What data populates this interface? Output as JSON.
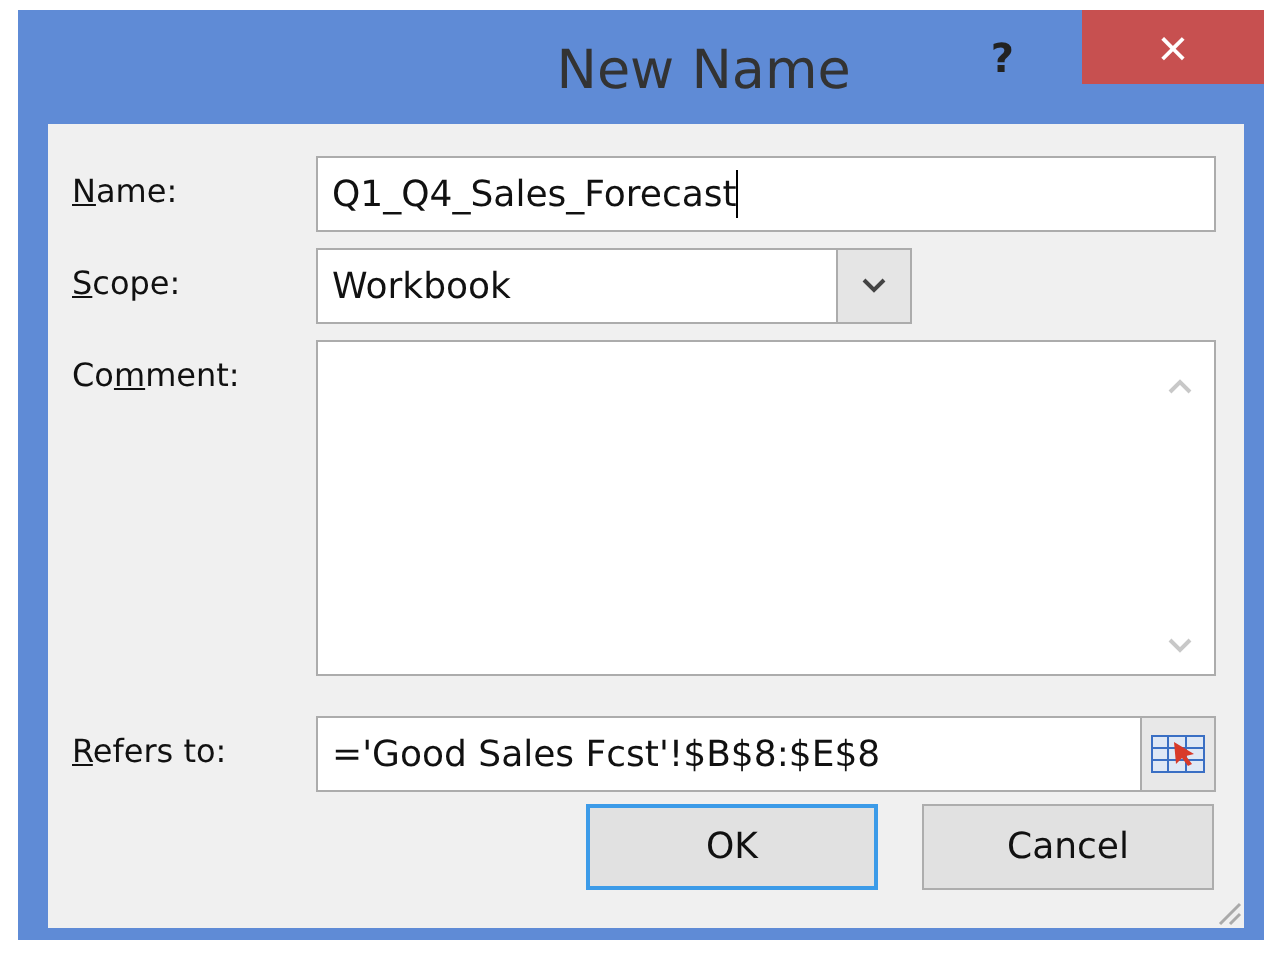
{
  "window": {
    "title": "New Name",
    "help": "?",
    "close": "×"
  },
  "fields": [
    {
      "kind": "text",
      "label": [
        {
          "text": "N",
          "access_key": true
        },
        {
          "text": "ame:",
          "access_key": false
        }
      ],
      "value": "Q1_Q4_Sales_Forecast",
      "focused": true
    },
    {
      "kind": "dropdown",
      "label": [
        {
          "text": "S",
          "access_key": true
        },
        {
          "text": "cope:",
          "access_key": false
        }
      ],
      "value": "Workbook"
    },
    {
      "kind": "memo",
      "label": [
        {
          "text": "Co",
          "access_key": false
        },
        {
          "text": "m",
          "access_key": true
        },
        {
          "text": "ment:",
          "access_key": false
        }
      ]
    },
    {
      "kind": "ref",
      "label": [
        {
          "text": "R",
          "access_key": true
        },
        {
          "text": "efers to:",
          "access_key": false
        }
      ],
      "value": "='Good Sales Fcst'!$B$8:$E$8"
    }
  ],
  "buttons": [
    {
      "label": "OK",
      "default": true
    },
    {
      "label": "Cancel",
      "default": false
    }
  ]
}
